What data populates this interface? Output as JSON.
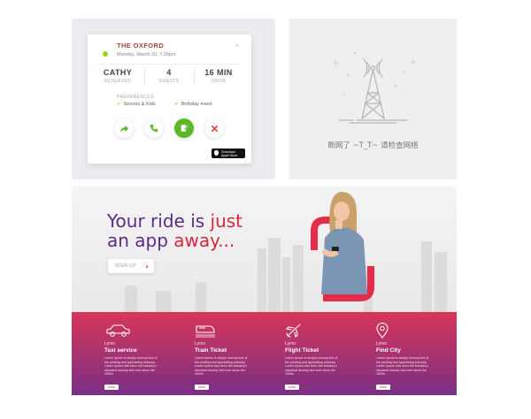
{
  "booking_card": {
    "venue": "THE OXFORD",
    "datetime": "Monday, March 20, 7:30pm",
    "stats": [
      {
        "value": "CATHY",
        "label": "RESERVED"
      },
      {
        "value": "4",
        "label": "GUESTS"
      },
      {
        "value": "16 MIN",
        "label": "DRIVE"
      }
    ],
    "preferences_title": "PREFERENCES",
    "preferences": [
      "Seniors & Kids",
      "Birthday event"
    ],
    "store_badge": {
      "line1": "Download",
      "line2": "Apple Store"
    },
    "accent": "#9ad20f"
  },
  "offline": {
    "message": "断网了 ~T_T~ 请检查网络"
  },
  "banner": {
    "headline_line1": "Your ride is just",
    "headline_line2": "an app away...",
    "signup_label": "SIGN UP",
    "services": [
      {
        "icon": "car-icon",
        "brand": "Lymo",
        "title": "Taxi service",
        "desc": "Lorem Ipsum is simply dummy text of the printing and typesetting industry. Lorem Ipsum has been the industry's standard dummy text ever since the 1500s",
        "more": "more"
      },
      {
        "icon": "train-icon",
        "brand": "Lymo",
        "title": "Train Ticket",
        "desc": "Lorem Ipsum is simply dummy text of the printing and typesetting industry. Lorem Ipsum has been the industry's standard dummy text ever since the 1500s",
        "more": "more"
      },
      {
        "icon": "plane-icon",
        "brand": "Lymo",
        "title": "Flight Ticket",
        "desc": "Lorem Ipsum is simply dummy text of the printing and typesetting industry. Lorem Ipsum has been the industry's standard dummy text ever since the 1500s",
        "more": "more"
      },
      {
        "icon": "map-pin-icon",
        "brand": "Lymo",
        "title": "Find City",
        "desc": "Lorem Ipsum is simply dummy text of the printing and typesetting industry. Lorem Ipsum has been the industry's standard dummy text ever since the 1500s",
        "more": "more"
      }
    ],
    "colors": {
      "purple": "#5a2c86",
      "red": "#d8263f"
    }
  }
}
